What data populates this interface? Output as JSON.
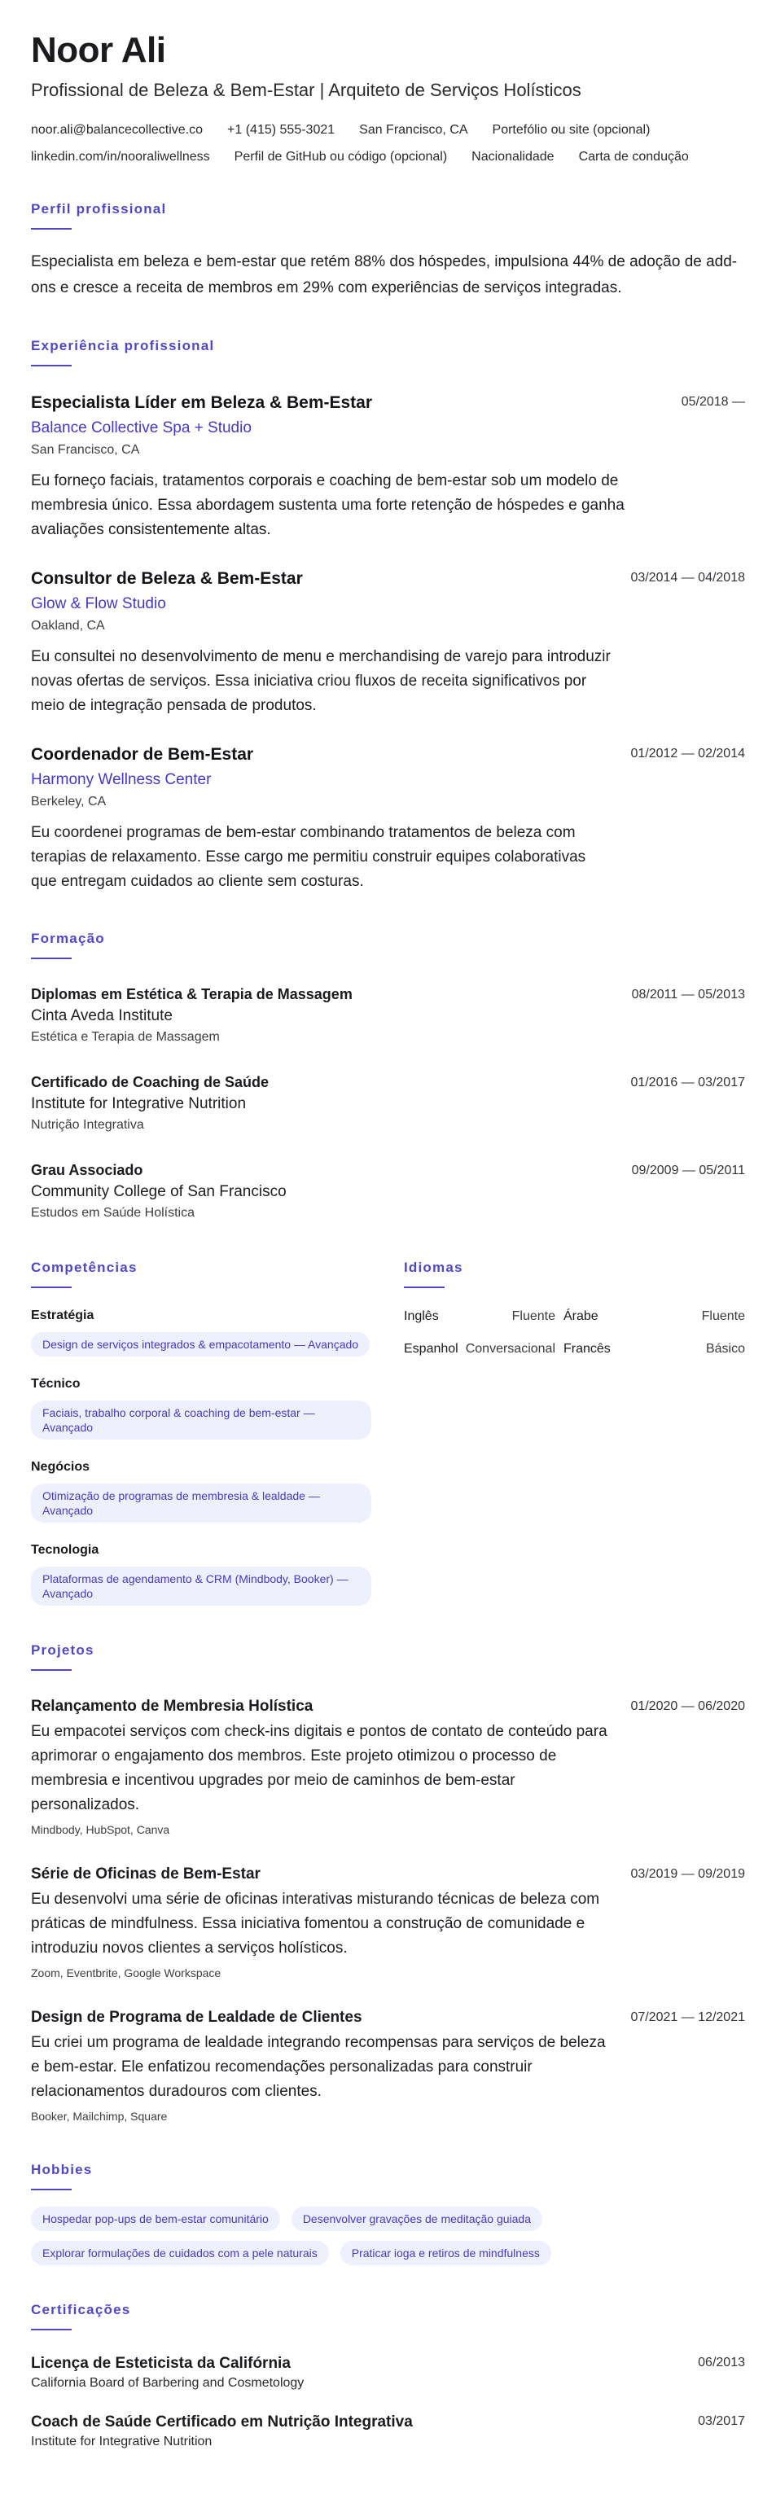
{
  "header": {
    "name": "Noor Ali",
    "headline": "Profissional de Beleza & Bem-Estar | Arquiteto de Serviços Holísticos",
    "contacts": [
      "noor.ali@balancecollective.co",
      "+1 (415) 555-3021",
      "San Francisco, CA",
      "Portefólio ou site (opcional)",
      "linkedin.com/in/nooraliwellness",
      "Perfil de GitHub ou código (opcional)",
      "Nacionalidade",
      "Carta de condução"
    ]
  },
  "profile": {
    "title": "Perfil profissional",
    "text": "Especialista em beleza e bem-estar que retém 88% dos hóspedes, impulsiona 44% de adoção de add-ons e cresce a receita de membros em 29% com experiências de serviços integradas."
  },
  "experience": {
    "title": "Experiência profissional",
    "items": [
      {
        "role": "Especialista Líder em Beleza & Bem-Estar",
        "company": "Balance Collective Spa + Studio",
        "location": "San Francisco, CA",
        "dates": "05/2018 —",
        "description": "Eu forneço faciais, tratamentos corporais e coaching de bem-estar sob um modelo de membresia único. Essa abordagem sustenta uma forte retenção de hóspedes e ganha avaliações consistentemente altas."
      },
      {
        "role": "Consultor de Beleza & Bem-Estar",
        "company": "Glow & Flow Studio",
        "location": "Oakland, CA",
        "dates": "03/2014 — 04/2018",
        "description": "Eu consultei no desenvolvimento de menu e merchandising de varejo para introduzir novas ofertas de serviços. Essa iniciativa criou fluxos de receita significativos por meio de integração pensada de produtos."
      },
      {
        "role": "Coordenador de Bem-Estar",
        "company": "Harmony Wellness Center",
        "location": "Berkeley, CA",
        "dates": "01/2012 — 02/2014",
        "description": "Eu coordenei programas de bem-estar combinando tratamentos de beleza com terapias de relaxamento. Esse cargo me permitiu construir equipes colaborativas que entregam cuidados ao cliente sem costuras."
      }
    ]
  },
  "education": {
    "title": "Formação",
    "items": [
      {
        "degree": "Diplomas em Estética & Terapia de Massagem",
        "institution": "Cinta Aveda Institute",
        "field": "Estética e Terapia de Massagem",
        "dates": "08/2011 — 05/2013"
      },
      {
        "degree": "Certificado de Coaching de Saúde",
        "institution": "Institute for Integrative Nutrition",
        "field": "Nutrição Integrativa",
        "dates": "01/2016 — 03/2017"
      },
      {
        "degree": "Grau Associado",
        "institution": "Community College of San Francisco",
        "field": "Estudos em Saúde Holística",
        "dates": "09/2009 — 05/2011"
      }
    ]
  },
  "skills": {
    "title": "Competências",
    "groups": [
      {
        "category": "Estratégia",
        "item": "Design de serviços integrados & empacotamento — Avançado"
      },
      {
        "category": "Técnico",
        "item": "Faciais, trabalho corporal & coaching de bem-estar — Avançado"
      },
      {
        "category": "Negócios",
        "item": "Otimização de programas de membresia & lealdade — Avançado"
      },
      {
        "category": "Tecnologia",
        "item": "Plataformas de agendamento & CRM (Mindbody, Booker) — Avançado"
      }
    ]
  },
  "languages": {
    "title": "Idiomas",
    "items": [
      {
        "language": "Inglês",
        "level": "Fluente"
      },
      {
        "language": "Árabe",
        "level": "Fluente"
      },
      {
        "language": "Espanhol",
        "level": "Conversacional"
      },
      {
        "language": "Francês",
        "level": "Básico"
      }
    ]
  },
  "projects": {
    "title": "Projetos",
    "items": [
      {
        "name": "Relançamento de Membresia Holística",
        "dates": "01/2020 — 06/2020",
        "description": "Eu empacotei serviços com check-ins digitais e pontos de contato de conteúdo para aprimorar o engajamento dos membros. Este projeto otimizou o processo de membresia e incentivou upgrades por meio de caminhos de bem-estar personalizados.",
        "tools": "Mindbody, HubSpot, Canva"
      },
      {
        "name": "Série de Oficinas de Bem-Estar",
        "dates": "03/2019 — 09/2019",
        "description": "Eu desenvolvi uma série de oficinas interativas misturando técnicas de beleza com práticas de mindfulness. Essa iniciativa fomentou a construção de comunidade e introduziu novos clientes a serviços holísticos.",
        "tools": "Zoom, Eventbrite, Google Workspace"
      },
      {
        "name": "Design de Programa de Lealdade de Clientes",
        "dates": "07/2021 — 12/2021",
        "description": "Eu criei um programa de lealdade integrando recompensas para serviços de beleza e bem-estar. Ele enfatizou recomendações personalizadas para construir relacionamentos duradouros com clientes.",
        "tools": "Booker, Mailchimp, Square"
      }
    ]
  },
  "hobbies": {
    "title": "Hobbies",
    "items": [
      "Hospedar pop-ups de bem-estar comunitário",
      "Desenvolver gravações de meditação guiada",
      "Explorar formulações de cuidados com a pele naturais",
      "Praticar ioga e retiros de mindfulness"
    ]
  },
  "certifications": {
    "title": "Certificações",
    "items": [
      {
        "name": "Licença de Esteticista da Califórnia",
        "issuer": "California Board of Barbering and Cosmetology",
        "date": "06/2013"
      },
      {
        "name": "Coach de Saúde Certificado em Nutrição Integrativa",
        "issuer": "Institute for Integrative Nutrition",
        "date": "03/2017"
      }
    ]
  },
  "colors": {
    "accent": "#5046c8",
    "pill_bg": "#eef0fd",
    "text": "#1b1b1f"
  }
}
